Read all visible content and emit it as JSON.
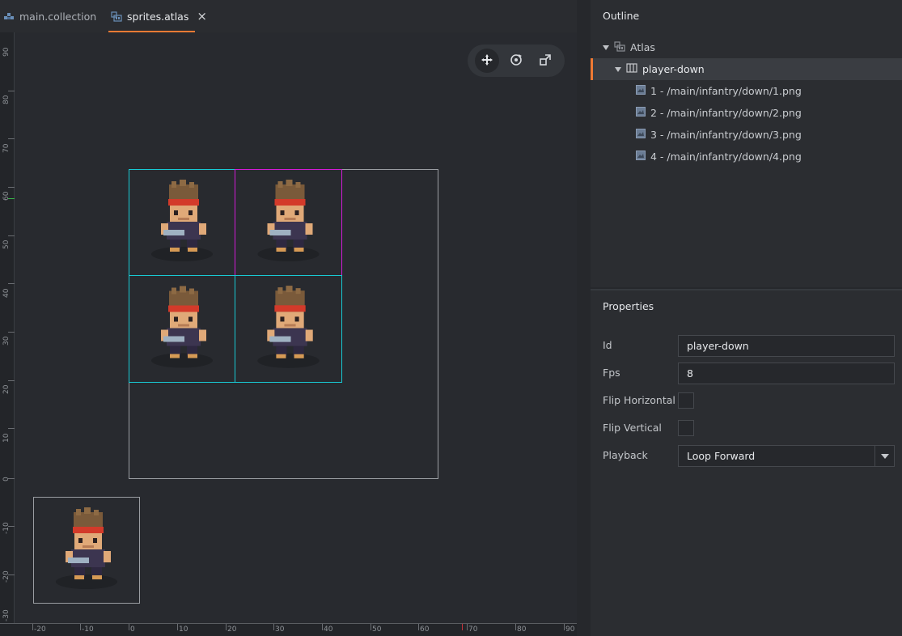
{
  "tabs": [
    {
      "label": "main.collection",
      "icon": "collection-icon",
      "active": false
    },
    {
      "label": "sprites.atlas",
      "icon": "atlas-icon",
      "active": true,
      "close": "×"
    }
  ],
  "scene": {
    "ruler_vertical_labels": [
      "90",
      "80",
      "70",
      "60",
      "50",
      "40",
      "30",
      "20",
      "10",
      "0",
      "-10",
      "-20",
      "-30"
    ],
    "ruler_horizontal_labels": [
      "-20",
      "-10",
      "0",
      "10",
      "20",
      "30",
      "40",
      "50",
      "60",
      "70",
      "80",
      "90"
    ],
    "toolbar": [
      {
        "icon": "move-icon",
        "active": true
      },
      {
        "icon": "rotate-icon",
        "active": false
      },
      {
        "icon": "scale-icon",
        "active": false
      }
    ],
    "colors": {
      "selected_frame": "#d21bd6",
      "frame": "#18c9d3",
      "accent": "#ef7a34"
    }
  },
  "outline": {
    "title": "Outline",
    "root": {
      "label": "Atlas",
      "icon": "atlas-icon"
    },
    "animation": {
      "label": "player-down",
      "icon": "animation-icon"
    },
    "images": [
      {
        "label": "1 - /main/infantry/down/1.png",
        "icon": "image-icon"
      },
      {
        "label": "2 - /main/infantry/down/2.png",
        "icon": "image-icon"
      },
      {
        "label": "3 - /main/infantry/down/3.png",
        "icon": "image-icon"
      },
      {
        "label": "4 - /main/infantry/down/4.png",
        "icon": "image-icon"
      }
    ]
  },
  "properties": {
    "title": "Properties",
    "id_label": "Id",
    "id_value": "player-down",
    "fps_label": "Fps",
    "fps_value": "8",
    "flip_h_label": "Flip Horizontal",
    "flip_v_label": "Flip Vertical",
    "playback_label": "Playback",
    "playback_value": "Loop Forward"
  }
}
